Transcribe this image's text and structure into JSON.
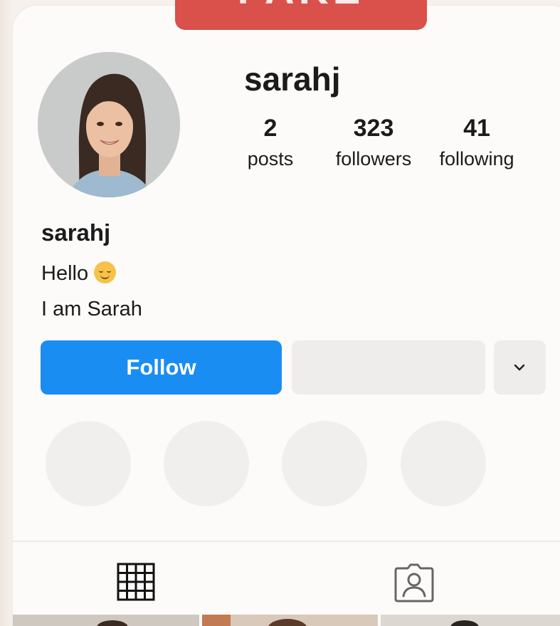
{
  "banner": {
    "label": "FAKE",
    "color": "#d9514a"
  },
  "profile": {
    "username": "sarahj",
    "avatar_icon": "profile-photo"
  },
  "stats": {
    "posts": {
      "value": "2",
      "label": "posts"
    },
    "followers": {
      "value": "323",
      "label": "followers"
    },
    "following": {
      "value": "41",
      "label": "following"
    }
  },
  "bio": {
    "name": "sarahj",
    "line1": "Hello",
    "line1_emoji": "smiling-face-icon",
    "line2": "I am Sarah"
  },
  "actions": {
    "follow_label": "Follow",
    "follow_color": "#1a8df3",
    "more_icon": "chevron-down-icon"
  },
  "highlights": [
    {
      "icon": "story-highlight-placeholder"
    },
    {
      "icon": "story-highlight-placeholder"
    },
    {
      "icon": "story-highlight-placeholder"
    },
    {
      "icon": "story-highlight-placeholder"
    }
  ],
  "tabs": [
    {
      "icon": "grid-icon"
    },
    {
      "icon": "tagged-user-icon"
    }
  ]
}
